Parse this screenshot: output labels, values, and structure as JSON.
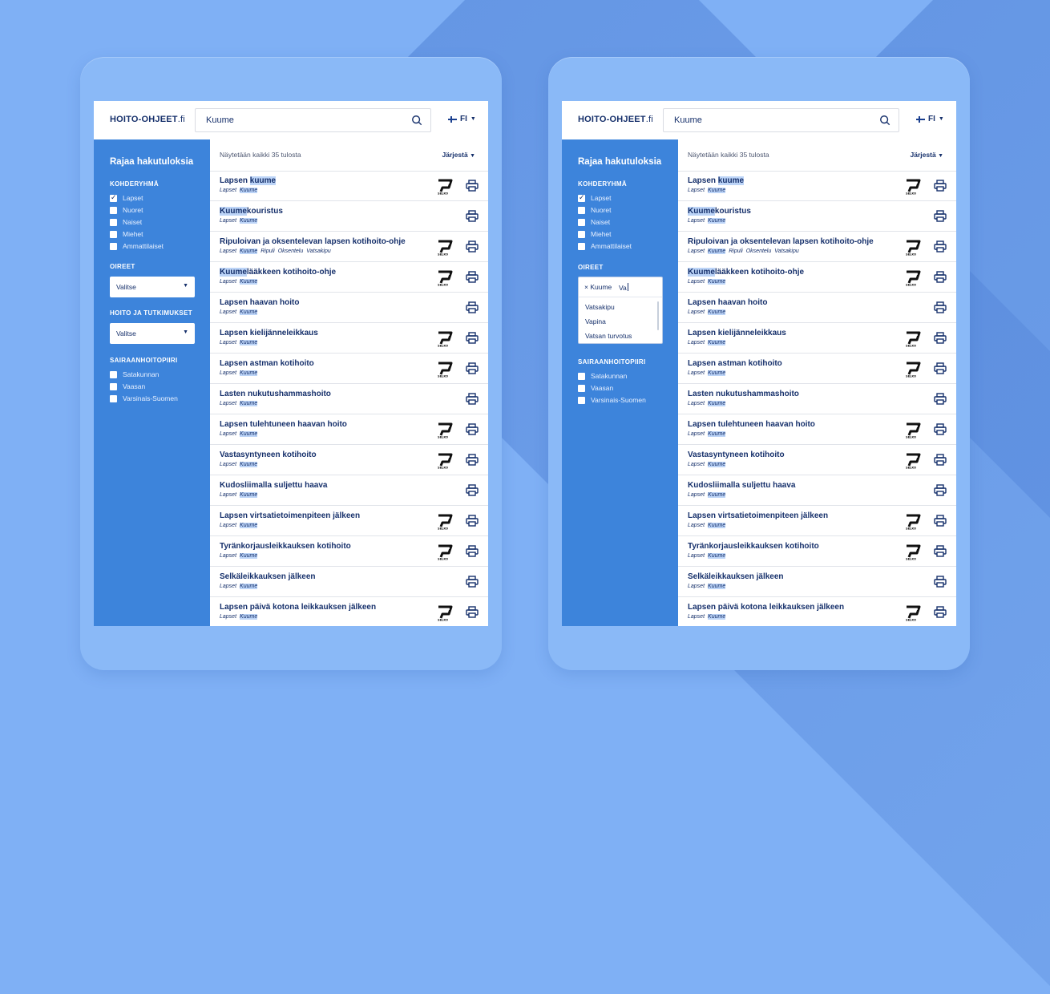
{
  "brand": {
    "logo_main": "HOITO-OHJEET",
    "logo_tld": ".fi"
  },
  "search": {
    "value": "Kuume",
    "placeholder": ""
  },
  "lang": "FI",
  "sidebar": {
    "title": "Rajaa hakutuloksia",
    "kohderyhma": {
      "heading": "KOHDERYHMÄ",
      "options": [
        {
          "label": "Lapset",
          "checked": true
        },
        {
          "label": "Nuoret",
          "checked": false
        },
        {
          "label": "Naiset",
          "checked": false
        },
        {
          "label": "Miehet",
          "checked": false
        },
        {
          "label": "Ammattilaiset",
          "checked": false
        }
      ]
    },
    "oireet": {
      "heading": "OIREET",
      "select_value": "Valitse"
    },
    "hoito": {
      "heading": "HOITO JA TUTKIMUKSET",
      "select_value": "Valitse"
    },
    "sairaanhoitopiiri": {
      "heading": "SAIRAANHOITOPIIRI",
      "options": [
        {
          "label": "Satakunnan",
          "checked": false
        },
        {
          "label": "Vaasan",
          "checked": false
        },
        {
          "label": "Varsinais-Suomen",
          "checked": false
        }
      ]
    }
  },
  "oireet_open": {
    "chip": "× Kuume",
    "typed": "Va",
    "options": [
      "Vatsakipu",
      "Vapina",
      "Vatsan turvotus"
    ]
  },
  "results": {
    "count_text": "Näytetään kaikki 35 tulosta",
    "sort_label": "Järjestä",
    "items": [
      {
        "title_pre": "Lapsen ",
        "title_hl": "kuume",
        "title_post": "",
        "tags": [
          "Lapset",
          "Kuume"
        ],
        "selko": true
      },
      {
        "title_pre": "",
        "title_hl": "Kuume",
        "title_post": "kouristus",
        "tags": [
          "Lapset",
          "Kuume"
        ],
        "selko": false
      },
      {
        "title_pre": "Ripuloivan ja oksentelevan lapsen kotihoito-ohje",
        "title_hl": "",
        "title_post": "",
        "tags": [
          "Lapset",
          "Kuume",
          "Ripuli",
          "Oksentelu",
          "Vatsakipu"
        ],
        "selko": true
      },
      {
        "title_pre": "",
        "title_hl": "Kuume",
        "title_post": "lääkkeen kotihoito-ohje",
        "tags": [
          "Lapset",
          "Kuume"
        ],
        "selko": true
      },
      {
        "title_pre": "Lapsen haavan hoito",
        "title_hl": "",
        "title_post": "",
        "tags": [
          "Lapset",
          "Kuume"
        ],
        "selko": false
      },
      {
        "title_pre": "Lapsen kielijänneleikkaus",
        "title_hl": "",
        "title_post": "",
        "tags": [
          "Lapset",
          "Kuume"
        ],
        "selko": true
      },
      {
        "title_pre": "Lapsen astman kotihoito",
        "title_hl": "",
        "title_post": "",
        "tags": [
          "Lapset",
          "Kuume"
        ],
        "selko": true
      },
      {
        "title_pre": "Lasten nukutushammashoito",
        "title_hl": "",
        "title_post": "",
        "tags": [
          "Lapset",
          "Kuume"
        ],
        "selko": false
      },
      {
        "title_pre": "Lapsen tulehtuneen haavan hoito",
        "title_hl": "",
        "title_post": "",
        "tags": [
          "Lapset",
          "Kuume"
        ],
        "selko": true
      },
      {
        "title_pre": "Vastasyntyneen kotihoito",
        "title_hl": "",
        "title_post": "",
        "tags": [
          "Lapset",
          "Kuume"
        ],
        "selko": true
      },
      {
        "title_pre": "Kudosliimalla suljettu haava",
        "title_hl": "",
        "title_post": "",
        "tags": [
          "Lapset",
          "Kuume"
        ],
        "selko": false
      },
      {
        "title_pre": "Lapsen virtsatietoimenpiteen jälkeen",
        "title_hl": "",
        "title_post": "",
        "tags": [
          "Lapset",
          "Kuume"
        ],
        "selko": true
      },
      {
        "title_pre": "Tyränkorjausleikkauksen kotihoito",
        "title_hl": "",
        "title_post": "",
        "tags": [
          "Lapset",
          "Kuume"
        ],
        "selko": true
      },
      {
        "title_pre": "Selkäleikkauksen jälkeen",
        "title_hl": "",
        "title_post": "",
        "tags": [
          "Lapset",
          "Kuume"
        ],
        "selko": false
      },
      {
        "title_pre": "Lapsen päivä kotona leikkauksen jälkeen",
        "title_hl": "",
        "title_post": "",
        "tags": [
          "Lapset",
          "Kuume"
        ],
        "selko": true
      }
    ]
  },
  "colors": {
    "background": "#7fb0f5",
    "tablet": "#8ab9f7",
    "sidebar": "#3d84db",
    "text_dark": "#16306b",
    "highlight": "#bcd4f7"
  },
  "icons": {
    "search": "search-icon",
    "print": "printer-icon",
    "selko": "selko-badge-icon",
    "flag": "finland-flag-icon"
  }
}
